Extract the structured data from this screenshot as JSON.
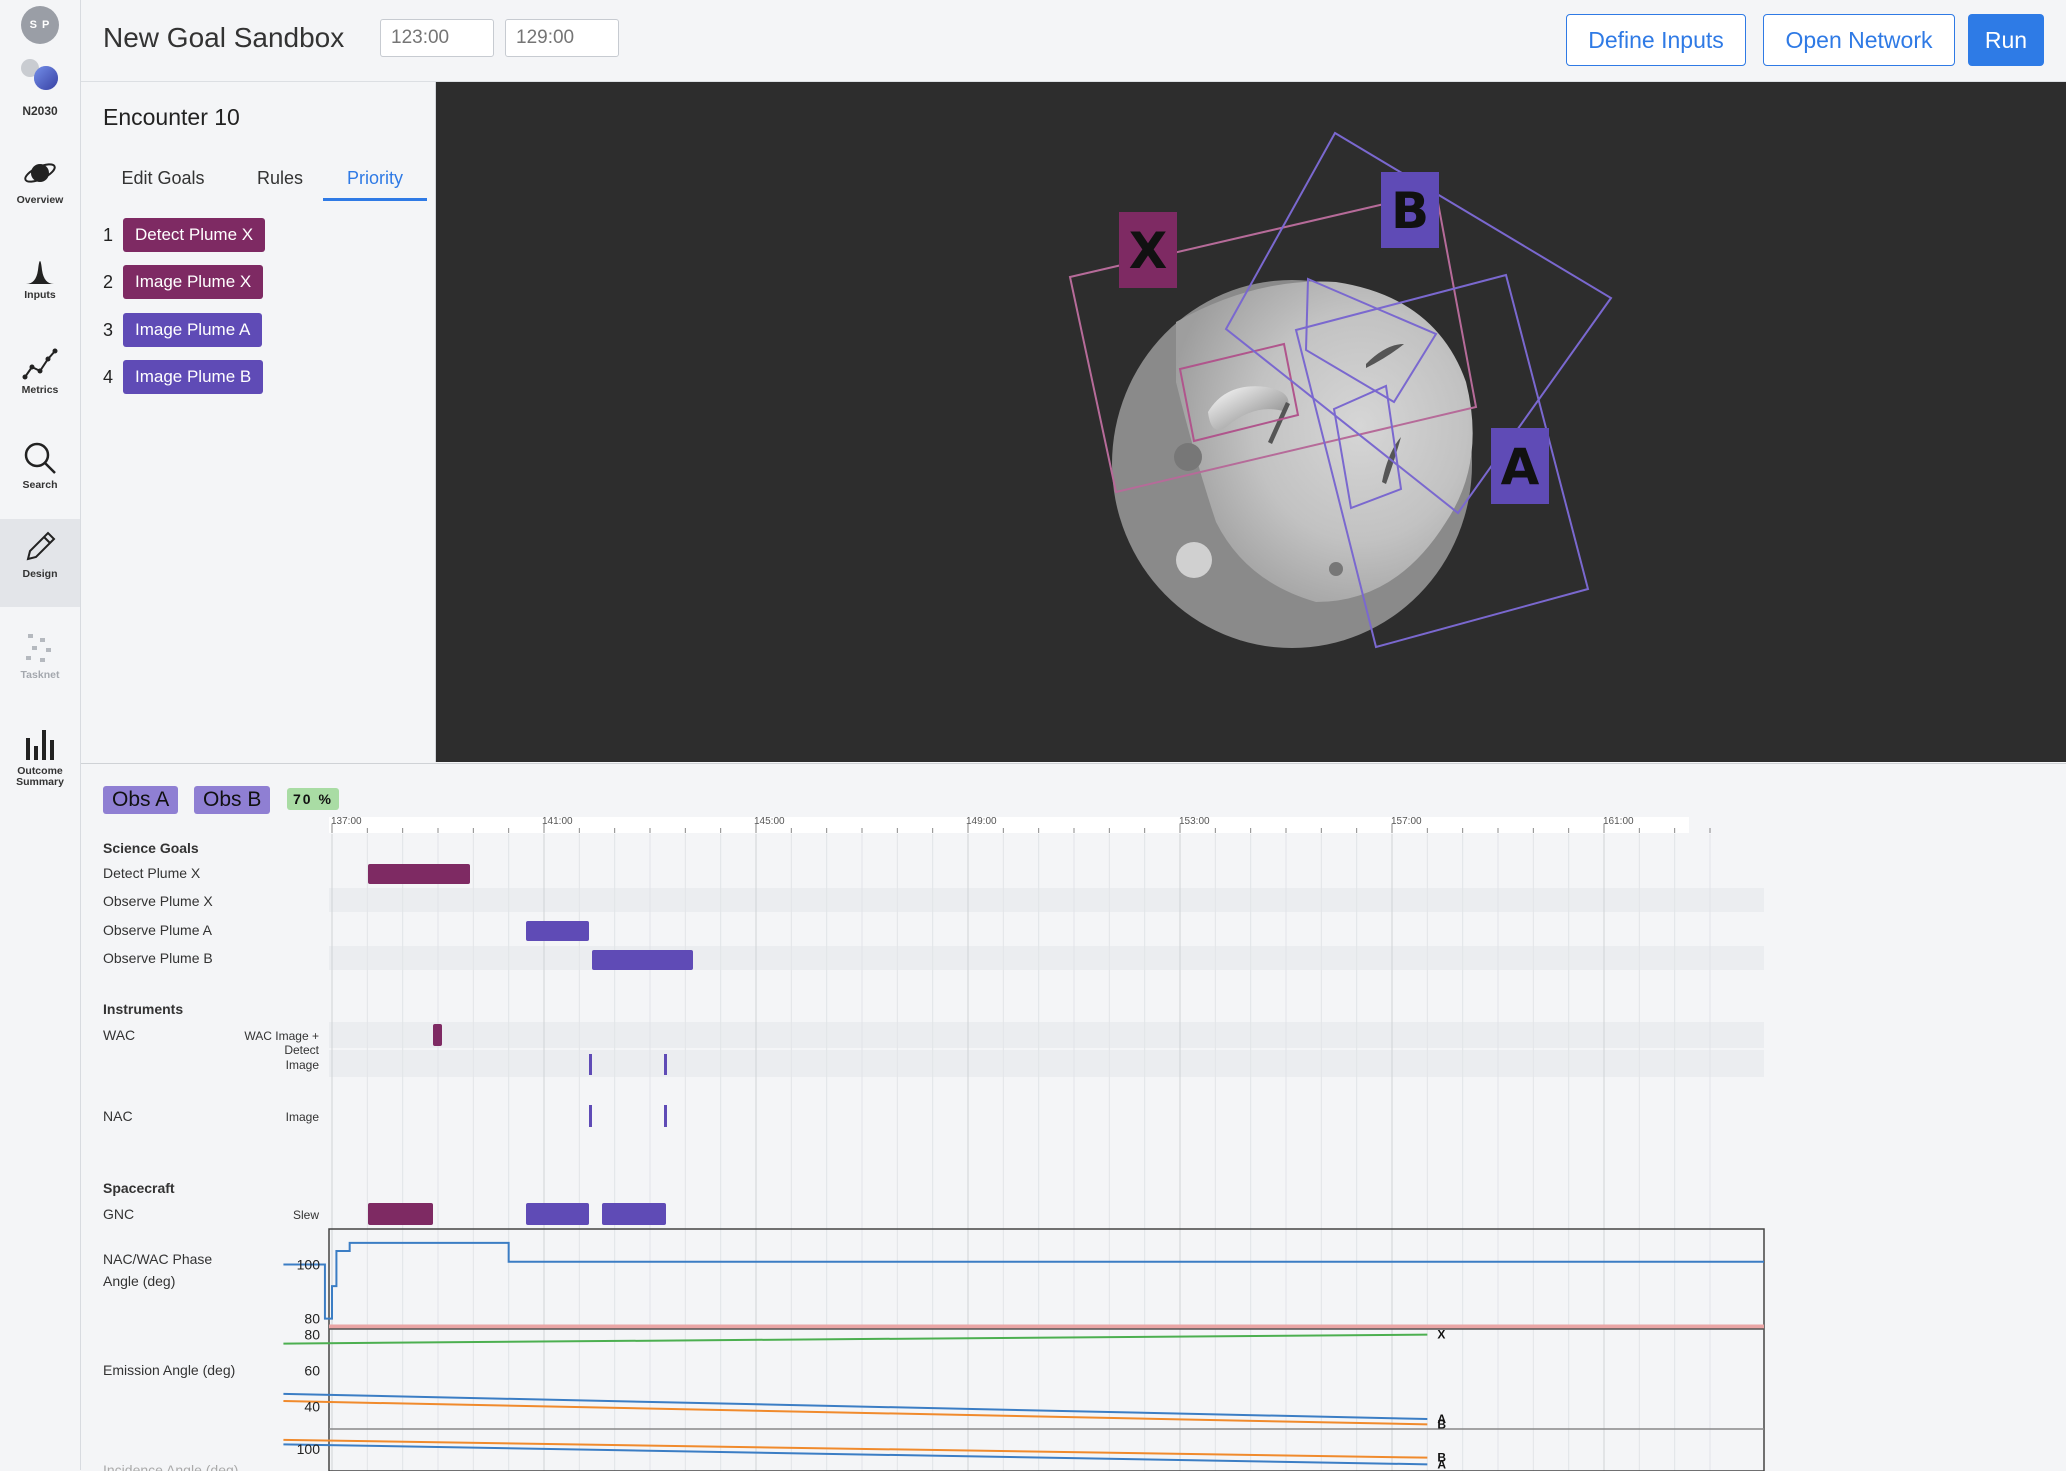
{
  "rail": {
    "avatar": "S P",
    "brand": "N2030",
    "items": [
      {
        "label": "Overview",
        "icon": "planet-icon"
      },
      {
        "label": "Inputs",
        "icon": "distribution-icon"
      },
      {
        "label": "Metrics",
        "icon": "line-chart-icon"
      },
      {
        "label": "Search",
        "icon": "search-icon"
      },
      {
        "label": "Design",
        "icon": "pencil-icon",
        "active": true
      },
      {
        "label": "Tasknet",
        "icon": "network-icon",
        "disabled": true
      },
      {
        "label": "Outcome Summary",
        "icon": "bar-chart-icon"
      }
    ]
  },
  "topbar": {
    "title": "New Goal Sandbox",
    "start_placeholder": "123:00",
    "end_placeholder": "129:00",
    "warning_glyph": "!",
    "define_inputs": "Define Inputs",
    "open_network": "Open Network",
    "run": "Run"
  },
  "goals": {
    "title": "Encounter 10",
    "tabs": [
      "Edit Goals",
      "Rules",
      "Priority"
    ],
    "active_tab": "Priority",
    "priority": [
      {
        "num": "1",
        "label": "Detect Plume X",
        "color": "#7e2a63"
      },
      {
        "num": "2",
        "label": "Image Plume X",
        "color": "#7e2a63"
      },
      {
        "num": "3",
        "label": "Image Plume A",
        "color": "#5f4bb6"
      },
      {
        "num": "4",
        "label": "Image Plume B",
        "color": "#5f4bb6"
      }
    ]
  },
  "viz": {
    "target_labels": [
      "X",
      "B",
      "A"
    ],
    "colors": {
      "x": "#7e2a63",
      "ab": "#5f4bb6"
    }
  },
  "timeline": {
    "obs_a": "Obs A",
    "obs_b": "Obs B",
    "percent": "70 %",
    "ticks": [
      "137:00",
      "141:00",
      "145:00",
      "149:00",
      "153:00",
      "157:00",
      "161:00"
    ],
    "sections": {
      "science": "Science Goals",
      "instruments": "Instruments",
      "spacecraft": "Spacecraft"
    },
    "lanes": {
      "detect_x": "Detect Plume X",
      "observe_x": "Observe Plume X",
      "observe_a": "Observe Plume A",
      "observe_b": "Observe Plume B",
      "wac": "WAC",
      "wac_sub1": "WAC Image + Detect",
      "wac_sub2": "Image",
      "nac": "NAC",
      "nac_sub": "Image",
      "gnc": "GNC",
      "gnc_sub": "Slew",
      "phase": "NAC/WAC Phase Angle (deg)",
      "emission": "Emission Angle (deg)",
      "incidence": "Incidence Angle (deg)"
    }
  },
  "chart_data": [
    {
      "type": "line",
      "title": "",
      "ylabel": "NAC/WAC Phase Angle (deg)",
      "xlim": [
        "136:00",
        "163:00"
      ],
      "ylim": [
        78,
        112
      ],
      "yticks": [
        "100",
        "80"
      ],
      "series": [
        {
          "x": [
            "136:05",
            "136:50",
            "136:52",
            "137:00",
            "137:05",
            "137:20",
            "140:10",
            "140:20",
            "163:00"
          ],
          "y": [
            100,
            100,
            80,
            92,
            105,
            108,
            108,
            101,
            101
          ]
        }
      ]
    },
    {
      "type": "line",
      "title": "",
      "ylabel": "Emission Angle (deg)",
      "xlim": [
        "136:00",
        "163:00"
      ],
      "ylim": [
        28,
        82
      ],
      "yticks": [
        "80",
        "60",
        "40"
      ],
      "series": [
        {
          "name": "X",
          "color": "#4caf50",
          "x": [
            "136:05",
            "157:40"
          ],
          "y": [
            75,
            80
          ]
        },
        {
          "name": "A",
          "color": "#3b7dc4",
          "x": [
            "136:05",
            "157:40"
          ],
          "y": [
            47,
            33
          ]
        },
        {
          "name": "B",
          "color": "#f08a2c",
          "x": [
            "136:05",
            "157:40"
          ],
          "y": [
            43,
            30
          ]
        }
      ]
    },
    {
      "type": "line",
      "title": "",
      "ylabel": "Incidence Angle (deg)",
      "xlim": [
        "136:00",
        "163:00"
      ],
      "ylim": [
        95,
        104
      ],
      "yticks": [
        "100"
      ],
      "series": [
        {
          "name": "B",
          "color": "#f08a2c",
          "x": [
            "136:05",
            "157:40"
          ],
          "y": [
            102,
            98
          ]
        },
        {
          "name": "A",
          "color": "#3b7dc4",
          "x": [
            "136:05",
            "157:40"
          ],
          "y": [
            101,
            96.5
          ]
        }
      ]
    }
  ]
}
